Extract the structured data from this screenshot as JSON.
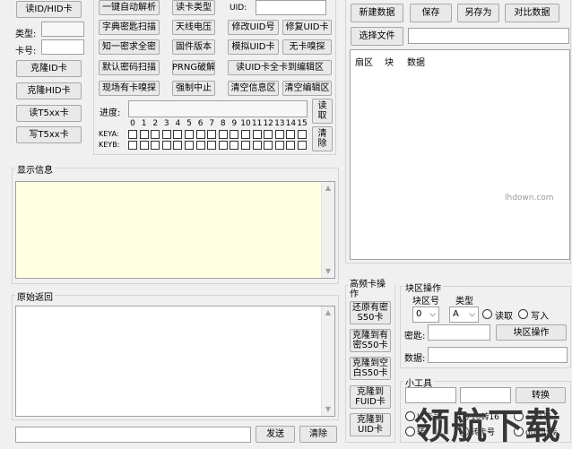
{
  "left": {
    "read_id_hid": "读ID/HID卡",
    "type_label": "类型:",
    "card_no_label": "卡号:",
    "clone_id": "克隆ID卡",
    "clone_hid": "克隆HID卡",
    "read_t5": "读T5xx卡",
    "write_t5": "写T5xx卡"
  },
  "middle": {
    "auto_parse": "一键自动解析",
    "read_card_type": "读卡类型",
    "uid_label": "UID:",
    "dict_scan": "字典密匙扫描",
    "antenna_voltage": "天线电压",
    "modify_uid": "修改UID号",
    "repair_uid": "修复UID卡",
    "know_one_key": "知一密求全密",
    "firmware": "固件版本",
    "simulate_uid": "模拟UID卡",
    "no_card_sniff": "无卡嗅探",
    "default_key_scan": "默认密码扫描",
    "prng_crack": "PRNG破解",
    "read_uid_all": "读UID卡全卡到编辑区",
    "field_card_sniff": "现场有卡嗅探",
    "force_stop": "强制中止",
    "clear_info": "清空信息区",
    "clear_edit": "清空编辑区",
    "progress_label": "进度:",
    "read_btn": "读取",
    "clear_btn": "清除",
    "keya_label": "KEYA:",
    "keyb_label": "KEYB:",
    "sector_numbers": [
      "0",
      "1",
      "2",
      "3",
      "4",
      "5",
      "6",
      "7",
      "8",
      "9",
      "10",
      "11",
      "12",
      "13",
      "14",
      "15"
    ]
  },
  "display_info": {
    "title": "显示信息"
  },
  "raw_return": {
    "title": "原始返回"
  },
  "bottom": {
    "send": "发送",
    "clear": "清除"
  },
  "right": {
    "new_data": "新建数据",
    "save": "保存",
    "save_as": "另存为",
    "compare": "对比数据",
    "select_file": "选择文件",
    "columns": [
      "扇区",
      "块",
      "数据"
    ]
  },
  "hf_ops": {
    "title": "高频卡操作",
    "restore_s50": "还原有密S50卡",
    "clone_to_keyed_s50": "克隆到有密S50卡",
    "clone_to_empty_s50": "克隆到空白S50卡",
    "clone_to_fuid": "克隆到FUID卡",
    "clone_to_uid": "克隆到UID卡"
  },
  "block_ops": {
    "title": "块区操作",
    "block_no_label": "块区号",
    "type_label": "类型",
    "block_value": "0",
    "type_value": "A",
    "read_radio": "读取",
    "write_radio": "写入",
    "key_label": "密匙:",
    "block_op_btn": "块区操作",
    "data_label": "数据:"
  },
  "tools": {
    "title": "小工具",
    "convert": "转换",
    "r1": "IC卡号",
    "r2": "10转16",
    "r3": "em1转",
    "r4": "转",
    "r5": "转卡号",
    "r6": "dump转"
  },
  "watermark": {
    "main": "领航下载",
    "sub": "lhdown.com"
  }
}
